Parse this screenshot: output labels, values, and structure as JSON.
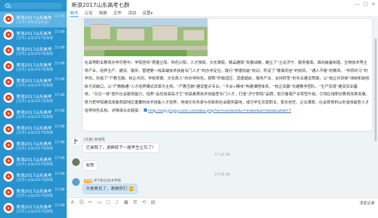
{
  "sidebar": {
    "conversations": [
      {
        "name": "新浪2017山东高考七群",
        "time": "17:15",
        "preview": "[文件] 学校还是专业?",
        "active": true
      },
      {
        "name": "新浪2017山东高考二群",
        "time": "17:08",
        "preview": "[文件] 山东2017年高考",
        "active": false
      },
      {
        "name": "新浪2017山东高考四群",
        "time": "17:08",
        "preview": "[文件] 山东2017年高考",
        "active": false
      },
      {
        "name": "新浪2017山东高考五群",
        "time": "17:08",
        "preview": "[文件] 山东2017年高考",
        "active": false
      },
      {
        "name": "新浪2017山东高考三群",
        "time": "17:08",
        "preview": "[文件] 山东2017年高考",
        "active": false
      },
      {
        "name": "新浪2017山东高考一群",
        "time": "17:08",
        "preview": "[文件] 山东2017年高考",
        "active": false
      },
      {
        "name": "新浪2017山东高考十群",
        "time": "17:08",
        "preview": "[文件] 山东2017年高考",
        "active": false
      },
      {
        "name": "新浪2017山东高考九群",
        "time": "17:08",
        "preview": "[文件] 山东2017年高考",
        "active": false
      },
      {
        "name": "新浪2017山东高考八群",
        "time": "17:08",
        "preview": "[文件] 山东2017年高考",
        "active": false
      },
      {
        "name": "新浪2017山东高考六群",
        "time": "17:08",
        "preview": "[文件] 山东2017年高考",
        "active": false
      },
      {
        "name": "新浪2017山东高考十一群",
        "time": "17:08",
        "preview": "[文件] 山东2017年高考",
        "active": false
      },
      {
        "name": "新浪2017山东高考十二群",
        "time": "17:08",
        "preview": "[文件] 山东2017年高考",
        "active": false
      },
      {
        "name": "新浪2017山东高考十三群",
        "time": "17:08",
        "preview": "[文件] 山东2017年高考",
        "active": false
      }
    ]
  },
  "header": {
    "title": "新浪2017山东高考七群",
    "tabs": [
      "聊天",
      "公告",
      "相册",
      "文件",
      "活动",
      "设置▾"
    ],
    "active_tab": 0
  },
  "messages": {
    "card_text": "在高等职业教育办学历程中，学院坚持“质量立院、特色兴院、人才强院、文化铸院、精品建院”发展战略，确立了“立足济宁、服务鲁南、面向装备制造、生物技术等主导产业，培养生产、建设、服务、管理第一线高端技术技能专门人才”的办学定位，践行“崇德尚能”校训，积淀了“敬事而信”的校风、“通人不倦”的教风、“学而时习”的学风，形成了“产教互融、校企共同、学校育德、文化育人”的办学特色。按照“积极适应、适度超前、服务产业、支持转型”的专业建设思路，以“校企共同体”体制机制创新为突破口，以“产教融通”人才培养模式改革为主线，“产教互融”建设重点专业，“平台+模块”构建课程体系，“校企双赢”共建教学团队，“生产实境”建设实训基地，“五位一体”提升社会服务能力，培养“品优技高有才艺”的高素质技术技能型专门人才，打造“济宁职院”品牌，助力鲁南产业转型升级，引领区域职业教育改革发展。努力把学院建设成鲁西南地区重要的技术技能人才培养、地域文化传承与创新和社会服务基地，成为学生实现职业、家长信任、企业满意、社会赞誉的山东省技能型人才培养特色名校。详情请点击链接：",
    "card_link": "http://zsjy.jnzjxy.com.cn/index.php?m=content&c=index&a=lists&catid=7",
    "items": [
      {
        "badge": "",
        "sender": "[法官] 新浪网",
        "text": "已录取了，退群给下一届考生让位了！",
        "smile": false,
        "blue": false
      },
      {
        "badge": "",
        "sender": "",
        "text": "祝贺",
        "smile": false,
        "blue": false
      },
      {
        "badge": "管理",
        "sender": "济宁职业技术学院",
        "text": "大家再见了，谢谢你们",
        "smile": true,
        "blue": true
      }
    ],
    "timestamps": [
      "17:12:28",
      "17:15:28"
    ]
  },
  "toolbar": {
    "icons": [
      "A",
      "☺",
      "✂",
      "▭",
      "▢",
      "♪",
      "▦",
      "☰",
      "⟲",
      "▤"
    ],
    "history_label": "消息记录"
  }
}
